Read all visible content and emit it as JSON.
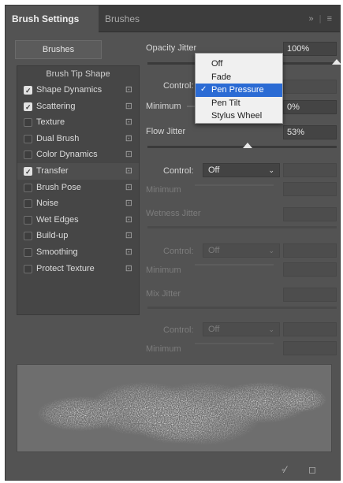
{
  "tabs": {
    "active": "Brush Settings",
    "inactive": "Brushes",
    "icons": [
      "double-chevron-right-icon",
      "menu-icon"
    ]
  },
  "left": {
    "brushes_button": "Brushes",
    "list_header": "Brush Tip Shape",
    "items": [
      {
        "label": "Shape Dynamics",
        "checked": true
      },
      {
        "label": "Scattering",
        "checked": true
      },
      {
        "label": "Texture",
        "checked": false
      },
      {
        "label": "Dual Brush",
        "checked": false
      },
      {
        "label": "Color Dynamics",
        "checked": false
      },
      {
        "label": "Transfer",
        "checked": true,
        "selected": true
      },
      {
        "label": "Brush Pose",
        "checked": false
      },
      {
        "label": "Noise",
        "checked": false
      },
      {
        "label": "Wet Edges",
        "checked": false
      },
      {
        "label": "Build-up",
        "checked": false
      },
      {
        "label": "Smoothing",
        "checked": false
      },
      {
        "label": "Protect Texture",
        "checked": false
      }
    ]
  },
  "opacity": {
    "label": "Opacity Jitter",
    "value": "100%",
    "level": 1.0,
    "control_label": "Control:",
    "minimum_label": "Minimum",
    "minimum_value": "0%"
  },
  "flow": {
    "label": "Flow Jitter",
    "value": "53%",
    "level": 0.53,
    "control_label": "Control:",
    "control_value": "Off",
    "minimum_label": "Minimum"
  },
  "wetness": {
    "label": "Wetness Jitter",
    "control_label": "Control:",
    "control_value": "Off",
    "minimum_label": "Minimum"
  },
  "mix": {
    "label": "Mix Jitter",
    "control_label": "Control:",
    "control_value": "Off",
    "minimum_label": "Minimum"
  },
  "dropdown_menu": {
    "options": [
      "Off",
      "Fade",
      "Pen Pressure",
      "Pen Tilt",
      "Stylus Wheel"
    ],
    "selected": "Pen Pressure"
  },
  "colors": {
    "panel": "#535353",
    "menu_highlight": "#2b6bd4"
  },
  "bottom_icons": [
    "eye-icon",
    "new-brush-icon"
  ]
}
